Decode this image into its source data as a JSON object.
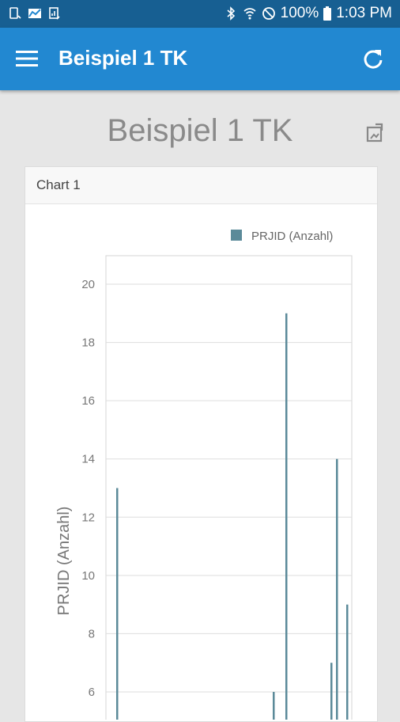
{
  "status_bar": {
    "battery": "100%",
    "time": "1:03 PM"
  },
  "app_bar": {
    "title": "Beispiel 1 TK"
  },
  "page": {
    "title": "Beispiel 1 TK"
  },
  "card": {
    "header": "Chart 1"
  },
  "colors": {
    "status_bar": "#175f92",
    "app_bar": "#2288d1",
    "series": "#5b8a99"
  },
  "chart_data": {
    "type": "bar",
    "ylabel": "PRJID (Anzahl)",
    "legend_position": "top-right",
    "grid": true,
    "ylim": [
      5,
      21
    ],
    "yticks": [
      6,
      8,
      10,
      12,
      14,
      16,
      18,
      20
    ],
    "series": [
      {
        "name": "PRJID (Anzahl)",
        "values": [
          13,
          6,
          19,
          7,
          14,
          9
        ]
      }
    ]
  }
}
